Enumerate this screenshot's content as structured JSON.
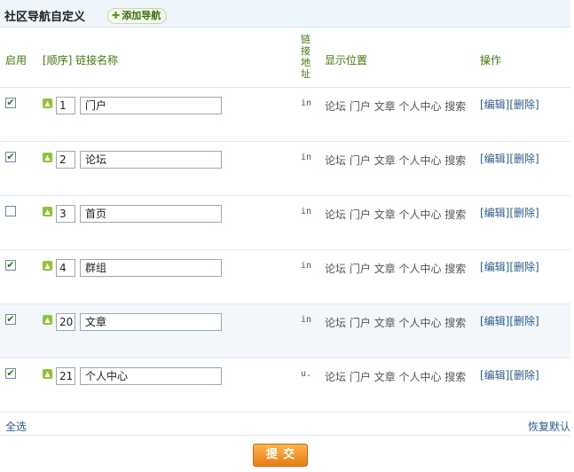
{
  "header": {
    "title": "社区导航自定义",
    "add_label": "添加导航"
  },
  "columns": {
    "enable": "启用",
    "order_name": "[顺序] 链接名称",
    "link": "链接地址",
    "display": "显示位置",
    "ops": "操作"
  },
  "rows": [
    {
      "checked": true,
      "order": "1",
      "name": "门户",
      "url": "in",
      "positions": "论坛 门户 文章 个人中心 搜索"
    },
    {
      "checked": true,
      "order": "2",
      "name": "论坛",
      "url": "in",
      "positions": "论坛 门户 文章 个人中心 搜索"
    },
    {
      "checked": false,
      "order": "3",
      "name": "首页",
      "url": "in",
      "positions": "论坛 门户 文章 个人中心 搜索"
    },
    {
      "checked": true,
      "order": "4",
      "name": "群组",
      "url": "in",
      "positions": "论坛 门户 文章 个人中心 搜索"
    },
    {
      "checked": true,
      "order": "20",
      "name": "文章",
      "url": "in",
      "positions": "论坛 门户 文章 个人中心 搜索"
    },
    {
      "checked": true,
      "order": "21",
      "name": "个人中心",
      "url": "u.",
      "positions": "论坛 门户 文章 个人中心 搜索"
    }
  ],
  "ops": {
    "edit": "[编辑]",
    "delete": "[删除]"
  },
  "footer": {
    "select_all": "全选",
    "restore": "恢复默认"
  },
  "submit_label": "提交"
}
